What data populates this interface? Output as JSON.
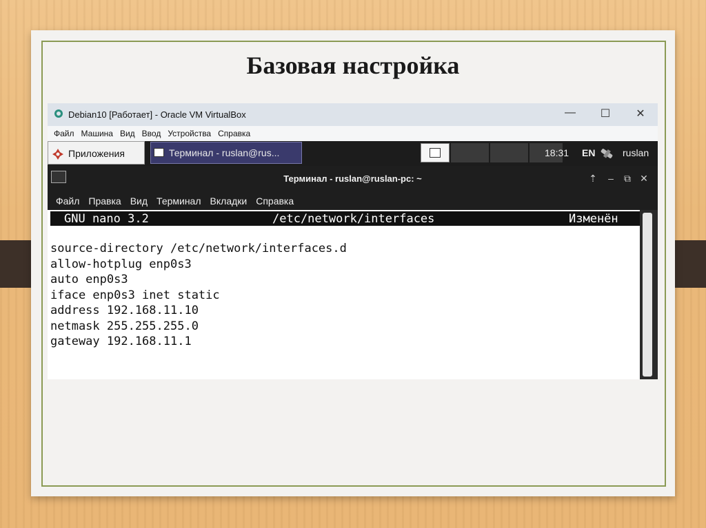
{
  "slide": {
    "title": "Базовая настройка"
  },
  "vbox": {
    "title": "Debian10 [Работает] - Oracle VM VirtualBox",
    "controls": {
      "minimize": "—",
      "maximize": "☐",
      "close": "✕"
    },
    "menu": [
      "Файл",
      "Машина",
      "Вид",
      "Ввод",
      "Устройства",
      "Справка"
    ]
  },
  "panel": {
    "apps_label": "Приложения",
    "task_label": "Терминал - ruslan@rus...",
    "clock": "18:31",
    "lang": "EN",
    "user": "ruslan"
  },
  "terminal": {
    "title": "Терминал - ruslan@ruslan-pc: ~",
    "menu": [
      "Файл",
      "Правка",
      "Вид",
      "Терминал",
      "Вкладки",
      "Справка"
    ],
    "nano": {
      "version": "GNU nano 3.2",
      "file": "/etc/network/interfaces",
      "status": "Изменён"
    },
    "lines": [
      "source-directory /etc/network/interfaces.d",
      "allow-hotplug enp0s3",
      "auto enp0s3",
      "iface enp0s3 inet static",
      "address 192.168.11.10",
      "netmask 255.255.255.0",
      "gateway 192.168.11.1"
    ]
  },
  "colors": {
    "frame_accent": "#8a9a54",
    "panel_bg": "#1c1c1c",
    "task_active": "#3a3a6c"
  }
}
